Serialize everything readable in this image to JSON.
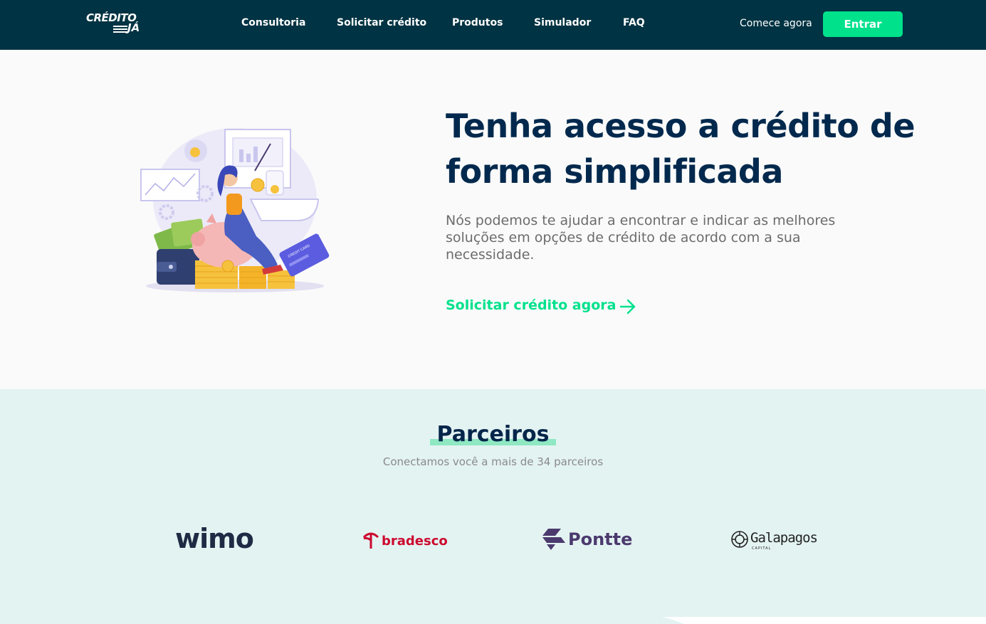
{
  "header": {
    "logo_line1": "CRÉDITO",
    "logo_line2": "JÁ",
    "nav": [
      "Consultoria",
      "Solicitar crédito",
      "Produtos",
      "Simulador",
      "FAQ"
    ],
    "comece_label": "Comece agora",
    "entrar_label": "Entrar"
  },
  "hero": {
    "title": "Tenha acesso a crédito de forma simplificada",
    "subtitle": "Nós podemos te ajudar a encontrar e indicar as melhores soluções em opções de crédito de acordo com a sua necessidade.",
    "cta_label": "Solicitar crédito agora",
    "illustration": "woman-on-piggy-bank-illustration",
    "card_text": "CREDIT CARD"
  },
  "partners": {
    "title": "Parceiros",
    "subtitle": "Conectamos você a mais de 34 parceiros",
    "logos": {
      "wimo": "wimo",
      "bradesco": "bradesco",
      "pontte": "Pontte",
      "galapagos": "Galapagos",
      "galapagos_sub": "CAPITAL"
    }
  },
  "colors": {
    "header_bg": "#003343",
    "accent": "#00e18c",
    "title": "#02294d",
    "partners_bg": "#e3f3f2"
  }
}
